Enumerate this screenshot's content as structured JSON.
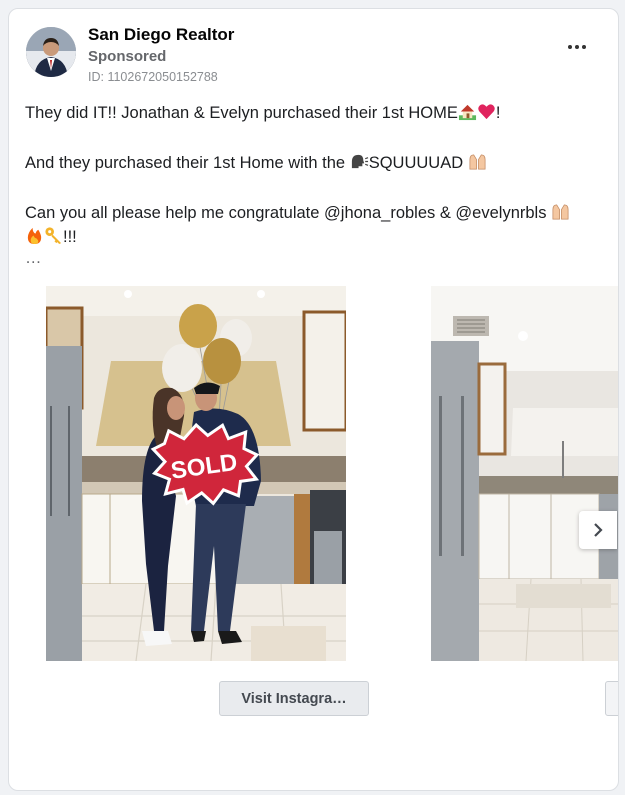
{
  "post": {
    "page_name": "San Diego Realtor",
    "sponsored": "Sponsored",
    "ad_id": "ID: 1102672050152788",
    "line1": "They did IT!! Jonathan & Evelyn purchased their 1st HOME",
    "line1_end": "!",
    "line2": "And they purchased their 1st Home with the ",
    "line2_tail": "SQUUUUAD ",
    "line3": "Can you all please help me congratulate @jhona_robles & @evelynrbls ",
    "line4_tail": "!!!",
    "ellipsis": "…"
  },
  "carousel": {
    "sign_text": "SOLD",
    "cta_label": "Visit Instagra…"
  },
  "icons": {
    "more": "more-options-icon",
    "house": "house-with-garden-icon",
    "heart": "red-heart-icon",
    "speaking": "speaking-head-icon",
    "raising_hands": "raising-hands-icon",
    "fire": "fire-icon",
    "key": "key-icon",
    "next": "chevron-right-icon"
  },
  "colors": {
    "text": "#1c1e21",
    "secondary": "#65676b",
    "heart": "#e0245e"
  }
}
